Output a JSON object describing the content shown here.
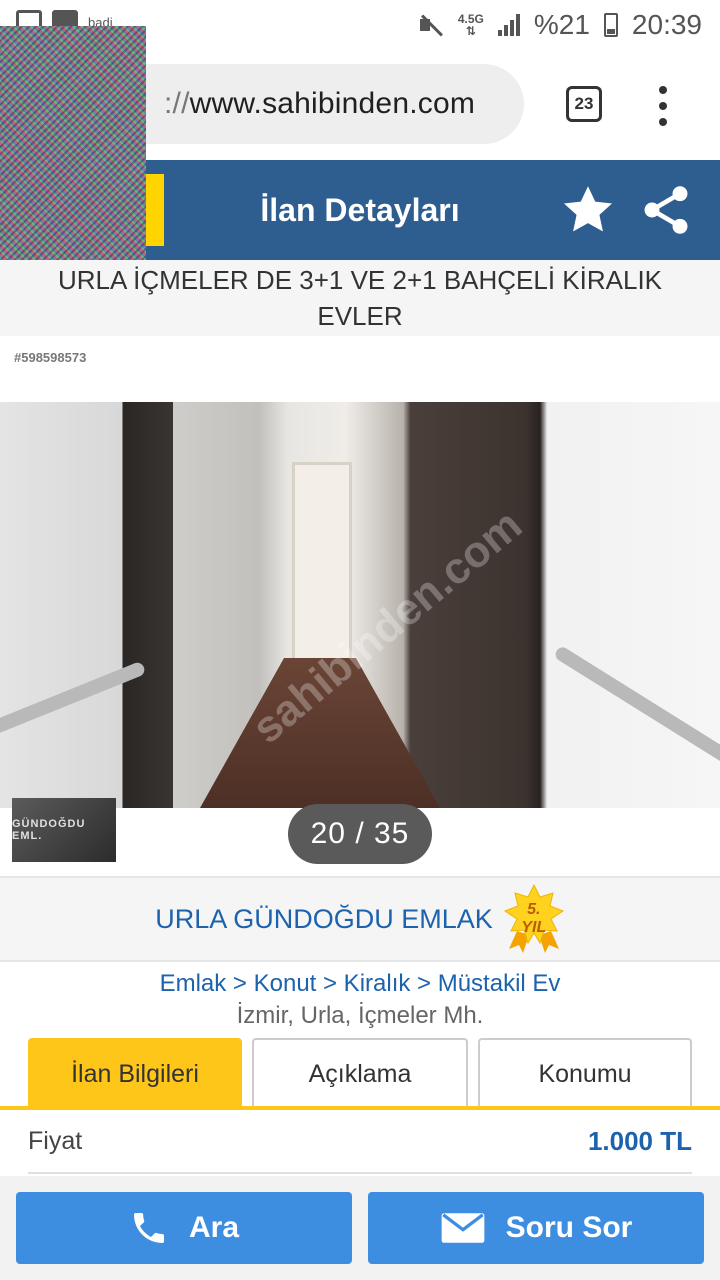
{
  "status_bar": {
    "carrier_hint": "badi",
    "network": "4.5G",
    "battery": "%21",
    "time": "20:39"
  },
  "browser": {
    "url_scheme": "://",
    "url_host": "www.sahibinden.com",
    "tab_count": "23"
  },
  "header": {
    "title": "İlan Detayları",
    "icons": [
      "star-icon",
      "share-icon"
    ]
  },
  "listing": {
    "title": "URLA İÇMELER DE 3+1 VE 2+1 BAHÇELİ KİRALIK EVLER",
    "number": "#598598573"
  },
  "photo": {
    "watermark": "sahibinden.com",
    "agency_badge": "GÜNDOĞDU EML.",
    "counter": "20 / 35"
  },
  "agency": {
    "name": "URLA GÜNDOĞDU EMLAK",
    "badge_line1": "5.",
    "badge_line2": "YIL"
  },
  "breadcrumb": {
    "text": "Emlak > Konut > Kiralık > Müstakil Ev",
    "location": "İzmir, Urla, İçmeler Mh."
  },
  "tabs": [
    {
      "label": "İlan Bilgileri",
      "active": true
    },
    {
      "label": "Açıklama",
      "active": false
    },
    {
      "label": "Konumu",
      "active": false
    }
  ],
  "details": {
    "price_label": "Fiyat",
    "price_value": "1.000 TL"
  },
  "actions": {
    "call_label": "Ara",
    "ask_label": "Soru Sor"
  },
  "colors": {
    "header_blue": "#2e5d8f",
    "link_blue": "#1c62ad",
    "accent_yellow": "#ffc61a",
    "button_blue": "#3d8ee0"
  }
}
